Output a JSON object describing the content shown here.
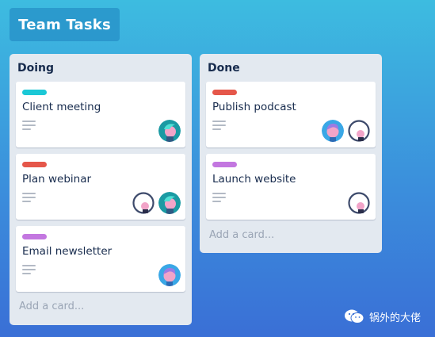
{
  "board": {
    "title": "Team Tasks"
  },
  "colors": {
    "teal": "#1bc8d6",
    "red": "#e5574a",
    "purple": "#c377e0"
  },
  "lists": [
    {
      "title": "Doing",
      "add_card": "Add a card...",
      "cards": [
        {
          "title": "Client meeting",
          "label_color": "teal",
          "avatars": [
            "teal-avatar"
          ]
        },
        {
          "title": "Plan webinar",
          "label_color": "red",
          "avatars": [
            "outline-avatar",
            "teal-avatar"
          ]
        },
        {
          "title": "Email newsletter",
          "label_color": "purple",
          "avatars": [
            "blue-avatar"
          ]
        }
      ]
    },
    {
      "title": "Done",
      "add_card": "Add a card...",
      "cards": [
        {
          "title": "Publish podcast",
          "label_color": "red",
          "avatars": [
            "blue-avatar",
            "outline-avatar"
          ]
        },
        {
          "title": "Launch website",
          "label_color": "purple",
          "avatars": [
            "outline-avatar"
          ]
        }
      ]
    }
  ],
  "watermark": {
    "text": "锅外的大佬",
    "icon": "wechat-icon"
  }
}
